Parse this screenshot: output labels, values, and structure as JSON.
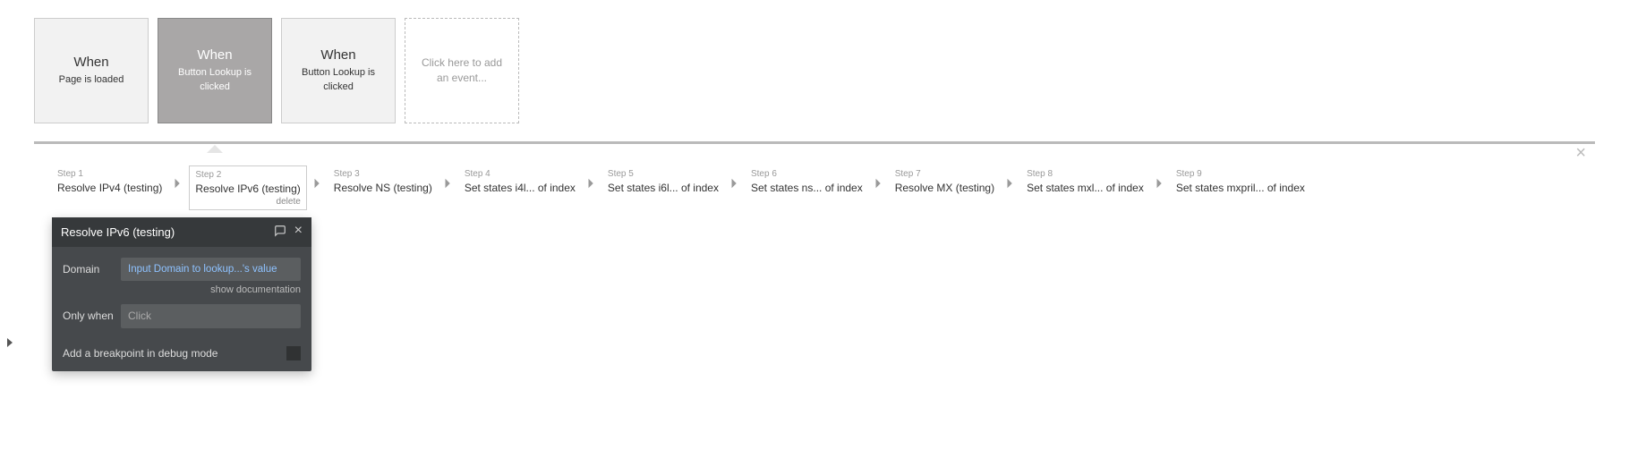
{
  "events": [
    {
      "title": "When",
      "subtitle": "Page is loaded",
      "selected": false
    },
    {
      "title": "When",
      "subtitle": "Button Lookup is clicked",
      "selected": true
    },
    {
      "title": "When",
      "subtitle": "Button Lookup is clicked",
      "selected": false
    }
  ],
  "add_event_placeholder": "Click here to add an event...",
  "steps": [
    {
      "label": "Step 1",
      "name": "Resolve IPv4 (testing)",
      "selected": false
    },
    {
      "label": "Step 2",
      "name": "Resolve IPv6 (testing)",
      "selected": true
    },
    {
      "label": "Step 3",
      "name": "Resolve NS (testing)",
      "selected": false
    },
    {
      "label": "Step 4",
      "name": "Set states i4l... of index",
      "selected": false
    },
    {
      "label": "Step 5",
      "name": "Set states i6l... of index",
      "selected": false
    },
    {
      "label": "Step 6",
      "name": "Set states ns... of index",
      "selected": false
    },
    {
      "label": "Step 7",
      "name": "Resolve MX (testing)",
      "selected": false
    },
    {
      "label": "Step 8",
      "name": "Set states mxl... of index",
      "selected": false
    },
    {
      "label": "Step 9",
      "name": "Set states mxpril... of index",
      "selected": false
    }
  ],
  "step_delete_label": "delete",
  "panel": {
    "title": "Resolve IPv6 (testing)",
    "domain_label": "Domain",
    "domain_value": "Input Domain to lookup...'s value",
    "show_doc": "show documentation",
    "only_when_label": "Only when",
    "only_when_placeholder": "Click",
    "breakpoint": "Add a breakpoint in debug mode"
  }
}
